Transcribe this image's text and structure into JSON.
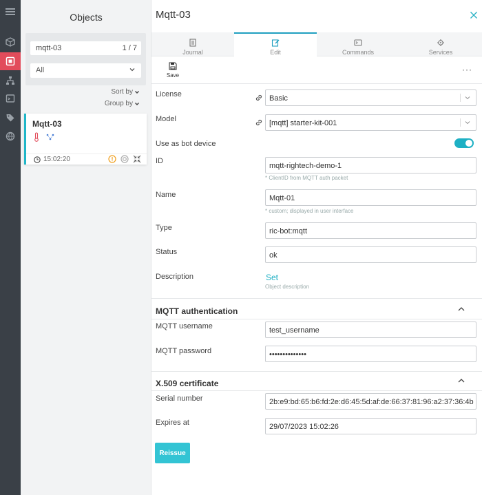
{
  "objects_panel": {
    "title": "Objects",
    "search_value": "mqtt-03",
    "search_count": "1 / 7",
    "filter_selected": "All",
    "sort_label": "Sort by",
    "group_label": "Group by",
    "card": {
      "title": "Mqtt-03",
      "time": "15:02:20"
    }
  },
  "main": {
    "title": "Mqtt-03",
    "tabs": [
      {
        "label": "Journal"
      },
      {
        "label": "Edit"
      },
      {
        "label": "Commands"
      },
      {
        "label": "Services"
      }
    ],
    "active_tab": "Edit",
    "save_label": "Save",
    "more_label": "···",
    "form": {
      "license": {
        "label": "License",
        "value": "Basic"
      },
      "model": {
        "label": "Model",
        "value": "[mqtt] starter-kit-001"
      },
      "bot_device": {
        "label": "Use as bot device",
        "enabled": true
      },
      "id": {
        "label": "ID",
        "value": "mqtt-rightech-demo-1",
        "hint": "* ClientID from MQTT auth packet"
      },
      "name": {
        "label": "Name",
        "value": "Mqtt-01",
        "hint": "* custom; displayed in user interface"
      },
      "type": {
        "label": "Type",
        "value": "ric-bot:mqtt"
      },
      "status": {
        "label": "Status",
        "value": "ok"
      },
      "description": {
        "label": "Description",
        "link": "Set",
        "hint": "Object description"
      }
    },
    "mqtt_section": {
      "title": "MQTT authentication",
      "username": {
        "label": "MQTT username",
        "value": "test_username"
      },
      "password": {
        "label": "MQTT password",
        "value": "••••••••••••••"
      }
    },
    "cert_section": {
      "title": "X.509 certificate",
      "serial": {
        "label": "Serial number",
        "value": "2b:e9:bd:65:b6:fd:2e:d6:45:5d:af:de:66:37:81:96:a2:37:36:4b"
      },
      "expires": {
        "label": "Expires at",
        "value": "29/07/2023 15:02:26"
      },
      "reissue_label": "Reissue"
    }
  },
  "colors": {
    "accent": "#1eb0c4",
    "active_nav": "#e24c5b",
    "rail": "#3a4047"
  }
}
